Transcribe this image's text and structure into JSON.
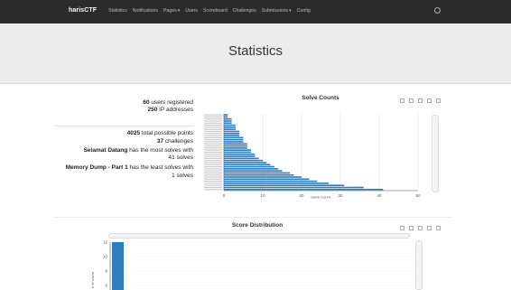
{
  "navbar": {
    "brand": "harisCTF",
    "items": [
      "Statistics",
      "Notifications",
      "Pages",
      "Users",
      "Scoreboard",
      "Challenges",
      "Submissions",
      "Config"
    ],
    "dropdown_items": [
      "Pages",
      "Submissions"
    ]
  },
  "header": {
    "title": "Statistics"
  },
  "stats": {
    "users_count": "60",
    "users_text": " users registered",
    "ip_count": "250",
    "ip_text": " IP addresses",
    "points": "4025",
    "points_text": " total possible points",
    "challenges": "37",
    "challenges_text": " challenges",
    "most_solved_name": "Selamat Datang",
    "most_solved_text": " has the most solves with",
    "most_solves": "41 solves",
    "least_solved_name": "Memory Dump - Part 1",
    "least_solved_text": " has the least solves with",
    "least_solves": "1 solves"
  },
  "solve_chart": {
    "title": "Solve Counts",
    "xlabel": "Solve Count"
  },
  "score_chart": {
    "title": "Score Distribution",
    "ylabel": "# of Users"
  },
  "chart_data": [
    {
      "type": "bar",
      "orientation": "horizontal",
      "title": "Solve Counts",
      "xlabel": "Solve Count",
      "xlim": [
        0,
        50
      ],
      "x_ticks": [
        0,
        10,
        20,
        30,
        40,
        50
      ],
      "values": [
        41,
        36,
        31,
        27,
        24,
        22,
        20,
        18,
        17,
        15,
        14,
        13,
        12,
        11,
        10,
        9,
        8,
        8,
        7,
        7,
        6,
        6,
        6,
        5,
        5,
        5,
        4,
        4,
        4,
        3,
        3,
        3,
        2,
        2,
        2,
        1,
        1
      ]
    },
    {
      "type": "bar",
      "title": "Score Distribution",
      "ylabel": "# of Users",
      "y_ticks": [
        12,
        10,
        8,
        6
      ],
      "values": [
        12
      ]
    }
  ]
}
